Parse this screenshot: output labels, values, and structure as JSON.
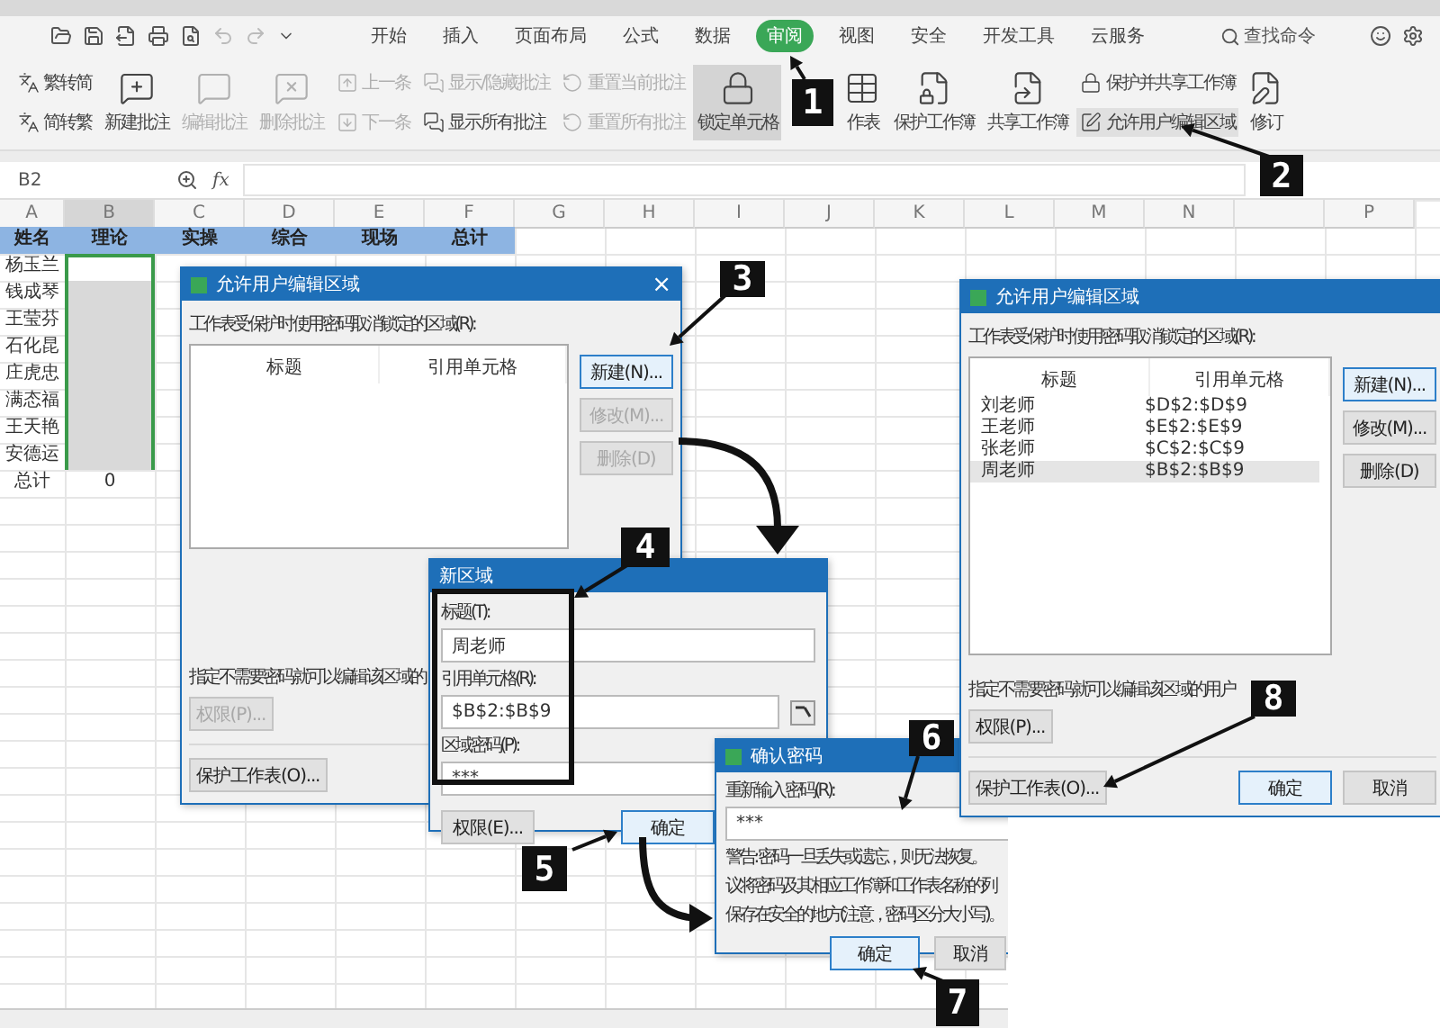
{
  "menu_tabs": [
    {
      "label": "开始",
      "selected": false
    },
    {
      "label": "插入",
      "selected": false
    },
    {
      "label": "页面布局",
      "selected": false
    },
    {
      "label": "公式",
      "selected": false
    },
    {
      "label": "数据",
      "selected": false
    },
    {
      "label": "审阅",
      "selected": true
    },
    {
      "label": "视图",
      "selected": false
    },
    {
      "label": "安全",
      "selected": false
    },
    {
      "label": "开发工具",
      "selected": false
    },
    {
      "label": "云服务",
      "selected": false
    }
  ],
  "search": {
    "placeholder": "查找命令"
  },
  "ribbon": [
    {
      "kind": "stack",
      "items": [
        {
          "label": "繁转简",
          "disabled": false
        },
        {
          "label": "简转繁",
          "disabled": false
        }
      ]
    },
    {
      "kind": "large",
      "label": "新建批注",
      "disabled": false,
      "selected": false
    },
    {
      "kind": "large",
      "label": "编辑批注",
      "disabled": true,
      "selected": false
    },
    {
      "kind": "large",
      "label": "删除批注",
      "disabled": true,
      "selected": false
    },
    {
      "kind": "stack",
      "items": [
        {
          "label": "上一条",
          "disabled": true
        },
        {
          "label": "下一条",
          "disabled": true
        }
      ]
    },
    {
      "kind": "stack",
      "items": [
        {
          "label": "显示/隐藏批注",
          "disabled": true
        },
        {
          "label": "显示所有批注",
          "disabled": false
        }
      ]
    },
    {
      "kind": "stack",
      "items": [
        {
          "label": "重置当前批注",
          "disabled": true
        },
        {
          "label": "重置所有批注",
          "disabled": true
        }
      ]
    },
    {
      "kind": "large",
      "label": "锁定单元格",
      "disabled": false,
      "selected": true
    },
    {
      "kind": "large",
      "label": "作表",
      "disabled": false,
      "selected": false
    },
    {
      "kind": "large",
      "label": "保护工作簿",
      "disabled": false,
      "selected": false
    },
    {
      "kind": "large",
      "label": "共享工作簿",
      "disabled": false,
      "selected": false
    },
    {
      "kind": "stack",
      "items": [
        {
          "label": "保护并共享工作簿",
          "disabled": false
        },
        {
          "label": "允许用户编辑区域",
          "disabled": false,
          "selected": true
        }
      ]
    },
    {
      "kind": "large",
      "label": "修订",
      "disabled": false,
      "selected": false
    }
  ],
  "name_box": "B2",
  "formula_label": "fx",
  "sheet": {
    "columns": [
      {
        "label": "A",
        "selected": false
      },
      {
        "label": "B",
        "selected": true
      },
      {
        "label": "C",
        "selected": false
      },
      {
        "label": "D",
        "selected": false
      },
      {
        "label": "E",
        "selected": false
      },
      {
        "label": "F",
        "selected": false
      },
      {
        "label": "G",
        "selected": false
      },
      {
        "label": "H",
        "selected": false
      },
      {
        "label": "I",
        "selected": false
      },
      {
        "label": "J",
        "selected": false
      },
      {
        "label": "K",
        "selected": false
      },
      {
        "label": "L",
        "selected": false
      },
      {
        "label": "M",
        "selected": false
      },
      {
        "label": "N",
        "selected": false
      },
      null,
      {
        "label": "P",
        "selected": false
      }
    ],
    "rows": [
      {
        "kind": "header",
        "cells": [
          "姓名",
          "理论",
          "实操",
          "综合",
          "现场",
          "总计"
        ]
      },
      {
        "kind": "data",
        "selected": true,
        "cells": [
          "杨玉兰"
        ]
      },
      {
        "kind": "data",
        "selected": true,
        "cells": [
          "钱成琴"
        ]
      },
      {
        "kind": "data",
        "selected": true,
        "cells": [
          "王莹芬"
        ]
      },
      {
        "kind": "data",
        "selected": true,
        "cells": [
          "石化昆"
        ]
      },
      {
        "kind": "data",
        "selected": true,
        "cells": [
          "庄虎忠"
        ]
      },
      {
        "kind": "data",
        "selected": true,
        "cells": [
          "满态福"
        ]
      },
      {
        "kind": "data",
        "selected": true,
        "cells": [
          "王天艳"
        ]
      },
      {
        "kind": "data",
        "selected": true,
        "cells": [
          "安德运"
        ]
      },
      {
        "kind": "data",
        "selected": false,
        "cells": [
          "总计",
          "0"
        ]
      }
    ]
  },
  "edit_ranges_dialog": {
    "title": "允许用户编辑区域",
    "close": "×",
    "list_label": "工作表受保护时使用密码取消锁定的区域(R):",
    "columns": [
      "标题",
      "引用单元格"
    ],
    "buttons": [
      {
        "label": "新建(N)...",
        "disabled": false,
        "focused": true
      },
      {
        "label": "修改(M)...",
        "disabled": true,
        "focused": false
      },
      {
        "label": "删除(D)",
        "disabled": true,
        "focused": false
      }
    ],
    "users_label": "指定不需要密码就可以编辑该区域的",
    "permissions_button": {
      "label": "权限(P)...",
      "disabled": true
    },
    "protect_button": {
      "label": "保护工作表(O)...",
      "disabled": false
    }
  },
  "new_range_dialog": {
    "title": "新区域",
    "fields": [
      {
        "label": "标题(T):",
        "value": "周老师"
      },
      {
        "label": "引用单元格(R):",
        "value": "$B$2:$B$9"
      },
      {
        "label": "区域密码(P):",
        "value": "***"
      }
    ],
    "buttons": [
      {
        "label": "权限(E)...",
        "focused": false
      },
      {
        "label": "确定",
        "focused": true
      }
    ]
  },
  "confirm_password_dialog": {
    "title": "确认密码",
    "field_label": "重新输入密码(R):",
    "value": "***",
    "warning": [
      "警告: 密码一旦丢失或遗忘，则无法恢复。",
      "议将密码及其相应工作簿和工作表名称的列",
      "保存在安全的地方(注意，密码区分大小写)。"
    ],
    "buttons": [
      {
        "label": "确定",
        "focused": true
      },
      {
        "label": "取消",
        "focused": false
      }
    ]
  },
  "edit_ranges_result_dialog": {
    "title": "允许用户编辑区域",
    "list_label": "工作表受保护时使用密码取消锁定的区域(R):",
    "columns": [
      "标题",
      "引用单元格"
    ],
    "rows": [
      {
        "title": "刘老师",
        "range": "$D$2:$D$9",
        "selected": false
      },
      {
        "title": "王老师",
        "range": "$E$2:$E$9",
        "selected": false
      },
      {
        "title": "张老师",
        "range": "$C$2:$C$9",
        "selected": false
      },
      {
        "title": "周老师",
        "range": "$B$2:$B$9",
        "selected": true
      }
    ],
    "buttons": [
      {
        "label": "新建(N)...",
        "disabled": false,
        "focused": true
      },
      {
        "label": "修改(M)...",
        "disabled": false,
        "focused": false
      },
      {
        "label": "删除(D)",
        "disabled": false,
        "focused": false
      }
    ],
    "users_label": "指定不需要密码就可以编辑该区域的用户",
    "permissions_button": {
      "label": "权限(P)...",
      "disabled": false
    },
    "protect_button": {
      "label": "保护工作表(O)...",
      "disabled": false
    },
    "footer_buttons": [
      {
        "label": "确定",
        "focused": true
      },
      {
        "label": "取消",
        "focused": false
      }
    ]
  },
  "annotations": [
    {
      "label": "1"
    },
    {
      "label": "2"
    },
    {
      "label": "3"
    },
    {
      "label": "4"
    },
    {
      "label": "5"
    },
    {
      "label": "6"
    },
    {
      "label": "7"
    },
    {
      "label": "8"
    }
  ]
}
